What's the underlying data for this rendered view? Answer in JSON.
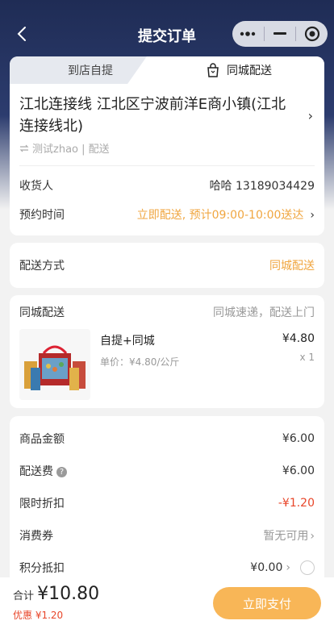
{
  "nav": {
    "title": "提交订单",
    "back_icon": "chevron-left-icon",
    "more_icon": "more-dots-icon",
    "minimize_icon": "minus-icon",
    "close_icon": "target-icon"
  },
  "tabs": {
    "pickup": "到店自提",
    "delivery": "同城配送",
    "delivery_icon": "shopping-bag-icon"
  },
  "address": {
    "title": "江北连接线 江北区宁波前洋E商小镇(江北连接线北)",
    "contact": "测试zhao | 配送",
    "swap_icon": "swap-icon"
  },
  "receiver": {
    "label": "收货人",
    "value": "哈哈 13189034429"
  },
  "schedule": {
    "label": "预约时间",
    "value": "立即配送, 预计09:00-10:00送达"
  },
  "delivery_method": {
    "label": "配送方式",
    "value": "同城配送"
  },
  "goods_section": {
    "title": "同城配送",
    "subtitle": "同城速递，配送上门"
  },
  "goods": {
    "name": "自提+同城",
    "unit_price": "单价：¥4.80/公斤",
    "amount": "¥4.80",
    "qty": "x 1"
  },
  "summary": {
    "goods_total": {
      "label": "商品金额",
      "value": "¥6.00"
    },
    "shipping": {
      "label": "配送费",
      "value": "¥6.00"
    },
    "discount": {
      "label": "限时折扣",
      "value": "-¥1.20"
    },
    "coupon": {
      "label": "消费券",
      "value": "暂无可用"
    },
    "points": {
      "label": "积分抵扣",
      "value": "¥0.00"
    }
  },
  "footer": {
    "total_label": "合计",
    "total_amount": "¥10.80",
    "discount": "优惠 ¥1.20",
    "pay": "立即支付"
  },
  "colors": {
    "accent": "#f0a640",
    "pay_button": "#f8b657",
    "discount_red": "#e8462a",
    "header_navy": "#1f2c55"
  }
}
